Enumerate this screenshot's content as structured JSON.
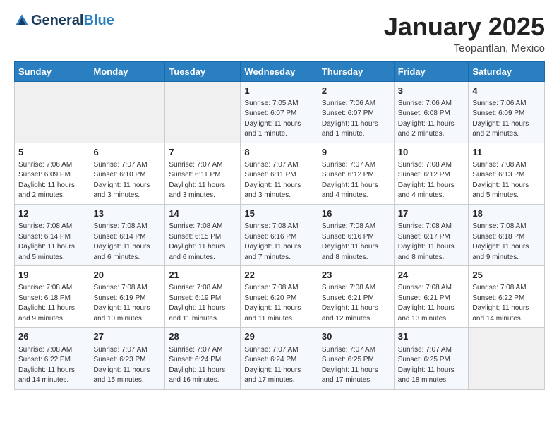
{
  "header": {
    "logo_general": "General",
    "logo_blue": "Blue",
    "month": "January 2025",
    "location": "Teopantlan, Mexico"
  },
  "days_of_week": [
    "Sunday",
    "Monday",
    "Tuesday",
    "Wednesday",
    "Thursday",
    "Friday",
    "Saturday"
  ],
  "weeks": [
    [
      {
        "day": "",
        "info": ""
      },
      {
        "day": "",
        "info": ""
      },
      {
        "day": "",
        "info": ""
      },
      {
        "day": "1",
        "info": "Sunrise: 7:05 AM\nSunset: 6:07 PM\nDaylight: 11 hours and 1 minute."
      },
      {
        "day": "2",
        "info": "Sunrise: 7:06 AM\nSunset: 6:07 PM\nDaylight: 11 hours and 1 minute."
      },
      {
        "day": "3",
        "info": "Sunrise: 7:06 AM\nSunset: 6:08 PM\nDaylight: 11 hours and 2 minutes."
      },
      {
        "day": "4",
        "info": "Sunrise: 7:06 AM\nSunset: 6:09 PM\nDaylight: 11 hours and 2 minutes."
      }
    ],
    [
      {
        "day": "5",
        "info": "Sunrise: 7:06 AM\nSunset: 6:09 PM\nDaylight: 11 hours and 2 minutes."
      },
      {
        "day": "6",
        "info": "Sunrise: 7:07 AM\nSunset: 6:10 PM\nDaylight: 11 hours and 3 minutes."
      },
      {
        "day": "7",
        "info": "Sunrise: 7:07 AM\nSunset: 6:11 PM\nDaylight: 11 hours and 3 minutes."
      },
      {
        "day": "8",
        "info": "Sunrise: 7:07 AM\nSunset: 6:11 PM\nDaylight: 11 hours and 3 minutes."
      },
      {
        "day": "9",
        "info": "Sunrise: 7:07 AM\nSunset: 6:12 PM\nDaylight: 11 hours and 4 minutes."
      },
      {
        "day": "10",
        "info": "Sunrise: 7:08 AM\nSunset: 6:12 PM\nDaylight: 11 hours and 4 minutes."
      },
      {
        "day": "11",
        "info": "Sunrise: 7:08 AM\nSunset: 6:13 PM\nDaylight: 11 hours and 5 minutes."
      }
    ],
    [
      {
        "day": "12",
        "info": "Sunrise: 7:08 AM\nSunset: 6:14 PM\nDaylight: 11 hours and 5 minutes."
      },
      {
        "day": "13",
        "info": "Sunrise: 7:08 AM\nSunset: 6:14 PM\nDaylight: 11 hours and 6 minutes."
      },
      {
        "day": "14",
        "info": "Sunrise: 7:08 AM\nSunset: 6:15 PM\nDaylight: 11 hours and 6 minutes."
      },
      {
        "day": "15",
        "info": "Sunrise: 7:08 AM\nSunset: 6:16 PM\nDaylight: 11 hours and 7 minutes."
      },
      {
        "day": "16",
        "info": "Sunrise: 7:08 AM\nSunset: 6:16 PM\nDaylight: 11 hours and 8 minutes."
      },
      {
        "day": "17",
        "info": "Sunrise: 7:08 AM\nSunset: 6:17 PM\nDaylight: 11 hours and 8 minutes."
      },
      {
        "day": "18",
        "info": "Sunrise: 7:08 AM\nSunset: 6:18 PM\nDaylight: 11 hours and 9 minutes."
      }
    ],
    [
      {
        "day": "19",
        "info": "Sunrise: 7:08 AM\nSunset: 6:18 PM\nDaylight: 11 hours and 9 minutes."
      },
      {
        "day": "20",
        "info": "Sunrise: 7:08 AM\nSunset: 6:19 PM\nDaylight: 11 hours and 10 minutes."
      },
      {
        "day": "21",
        "info": "Sunrise: 7:08 AM\nSunset: 6:19 PM\nDaylight: 11 hours and 11 minutes."
      },
      {
        "day": "22",
        "info": "Sunrise: 7:08 AM\nSunset: 6:20 PM\nDaylight: 11 hours and 11 minutes."
      },
      {
        "day": "23",
        "info": "Sunrise: 7:08 AM\nSunset: 6:21 PM\nDaylight: 11 hours and 12 minutes."
      },
      {
        "day": "24",
        "info": "Sunrise: 7:08 AM\nSunset: 6:21 PM\nDaylight: 11 hours and 13 minutes."
      },
      {
        "day": "25",
        "info": "Sunrise: 7:08 AM\nSunset: 6:22 PM\nDaylight: 11 hours and 14 minutes."
      }
    ],
    [
      {
        "day": "26",
        "info": "Sunrise: 7:08 AM\nSunset: 6:22 PM\nDaylight: 11 hours and 14 minutes."
      },
      {
        "day": "27",
        "info": "Sunrise: 7:07 AM\nSunset: 6:23 PM\nDaylight: 11 hours and 15 minutes."
      },
      {
        "day": "28",
        "info": "Sunrise: 7:07 AM\nSunset: 6:24 PM\nDaylight: 11 hours and 16 minutes."
      },
      {
        "day": "29",
        "info": "Sunrise: 7:07 AM\nSunset: 6:24 PM\nDaylight: 11 hours and 17 minutes."
      },
      {
        "day": "30",
        "info": "Sunrise: 7:07 AM\nSunset: 6:25 PM\nDaylight: 11 hours and 17 minutes."
      },
      {
        "day": "31",
        "info": "Sunrise: 7:07 AM\nSunset: 6:25 PM\nDaylight: 11 hours and 18 minutes."
      },
      {
        "day": "",
        "info": ""
      }
    ]
  ]
}
